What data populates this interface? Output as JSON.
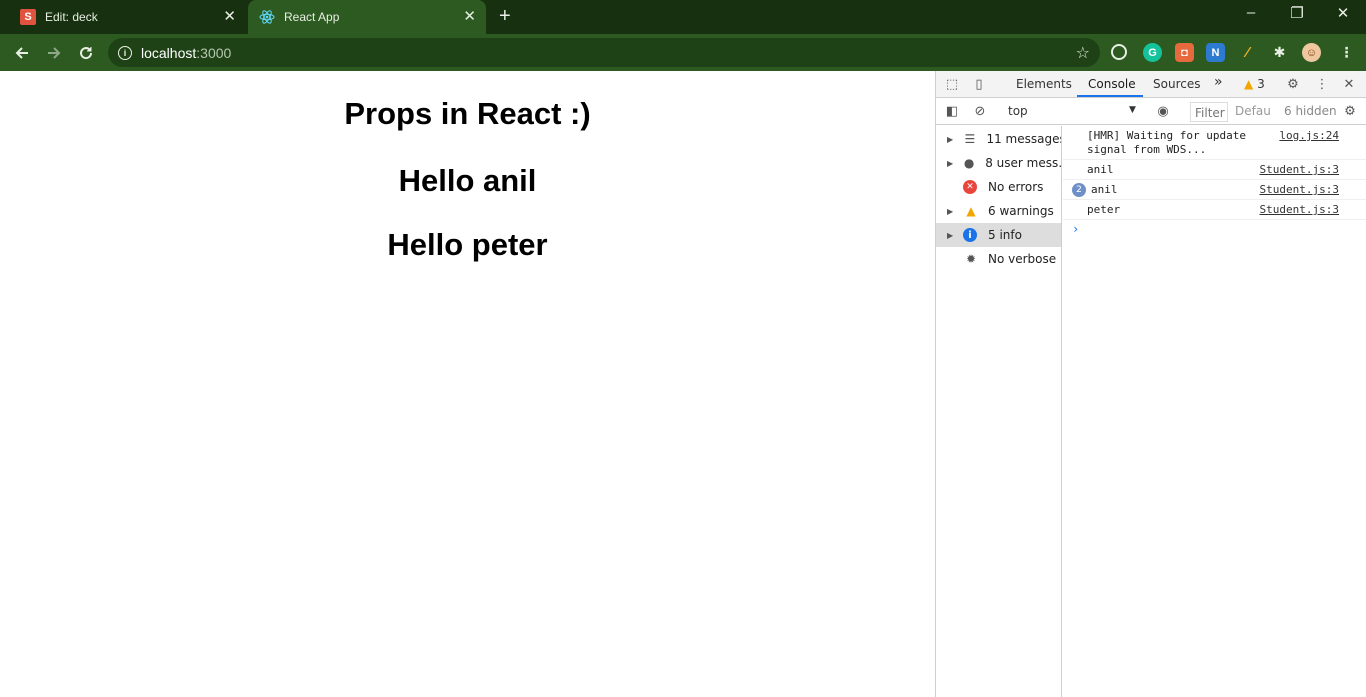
{
  "browser": {
    "tabs": [
      {
        "title": "Edit: deck",
        "favicon": "S",
        "active": false
      },
      {
        "title": "React App",
        "favicon": "react-logo",
        "active": true
      }
    ],
    "new_tab_label": "+",
    "window_controls": {
      "minimize": "–",
      "restore": "❐",
      "close": "✕"
    },
    "address_bar": {
      "host": "localhost",
      "port": ":3000"
    }
  },
  "page": {
    "heading": "Props in React :)",
    "greetings": [
      "Hello anil",
      "Hello peter"
    ]
  },
  "devtools": {
    "tabs": [
      "Elements",
      "Console",
      "Sources"
    ],
    "active_tab": "Console",
    "more_tabs": "»",
    "warning_count": "3",
    "context": "top",
    "filter_placeholder": "Filter",
    "levels_label": "Defau",
    "hidden_count": "6 hidden",
    "sidebar": [
      {
        "label": "11 messages",
        "icon": "list-icon",
        "expandable": true
      },
      {
        "label": "8 user mess…",
        "icon": "user-icon",
        "expandable": true
      },
      {
        "label": "No errors",
        "icon": "error-icon",
        "expandable": false
      },
      {
        "label": "6 warnings",
        "icon": "warning-icon",
        "expandable": true
      },
      {
        "label": "5 info",
        "icon": "info-icon",
        "expandable": true,
        "selected": true
      },
      {
        "label": "No verbose",
        "icon": "bug-icon",
        "expandable": false
      }
    ],
    "console": [
      {
        "text_line1": "[HMR] Waiting for update",
        "text_line2": "signal from WDS...",
        "source": "log.js:24"
      },
      {
        "text": "anil",
        "source": "Student.js:3"
      },
      {
        "text": "anil",
        "source": "Student.js:3",
        "repeat": "2"
      },
      {
        "text": "peter",
        "source": "Student.js:3"
      }
    ],
    "prompt": "›"
  },
  "colors": {
    "chrome_dark": "#17300f",
    "chrome_toolbar": "#2c5a20",
    "devtools_accent": "#1a73e8",
    "warning": "#f2a600",
    "error": "#e8453c",
    "info": "#1a73e8"
  }
}
